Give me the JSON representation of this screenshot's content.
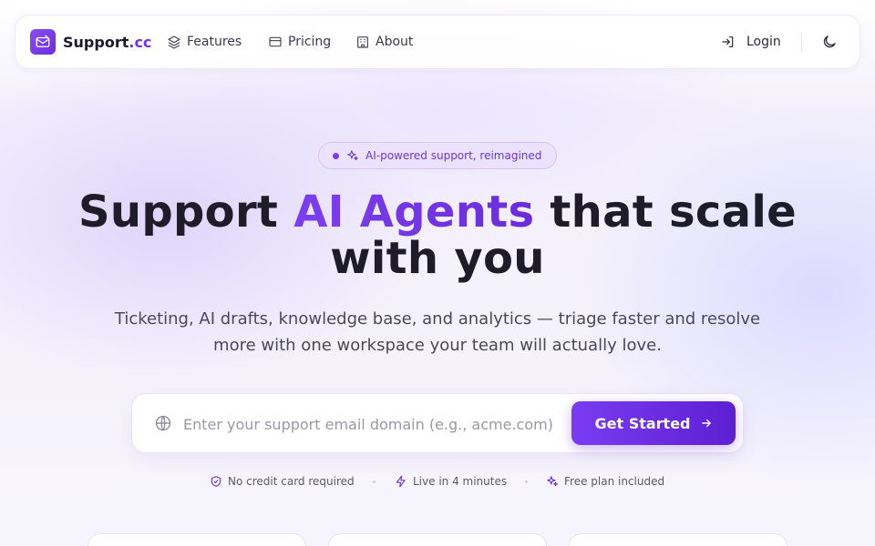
{
  "brand": {
    "name": "Support",
    "tld": ".cc"
  },
  "nav": {
    "links": [
      {
        "label": "Features",
        "icon": "layers-icon"
      },
      {
        "label": "Pricing",
        "icon": "card-icon"
      },
      {
        "label": "About",
        "icon": "building-icon"
      }
    ],
    "login_label": "Login",
    "theme_icon": "moon-icon"
  },
  "hero": {
    "badge": "AI-powered support, reimagined",
    "headline_pre": "Support ",
    "headline_accent": "AI Agents",
    "headline_post": " that scale with you",
    "subtitle": "Ticketing, AI drafts, knowledge base, and analytics — triage faster and resolve more with one workspace your team will actually love."
  },
  "form": {
    "placeholder": "Enter your support email domain (e.g., acme.com)",
    "value": "",
    "cta_label": "Get Started"
  },
  "perks": [
    {
      "label": "No credit card required",
      "icon": "shield-check-icon"
    },
    {
      "label": "Live in 4 minutes",
      "icon": "bolt-icon"
    },
    {
      "label": "Free plan included",
      "icon": "sparkles-icon"
    }
  ],
  "colors": {
    "accent": "#6d35e8",
    "accent_light": "#ece2fd",
    "text": "#1e1c28",
    "muted": "#4a4858"
  }
}
